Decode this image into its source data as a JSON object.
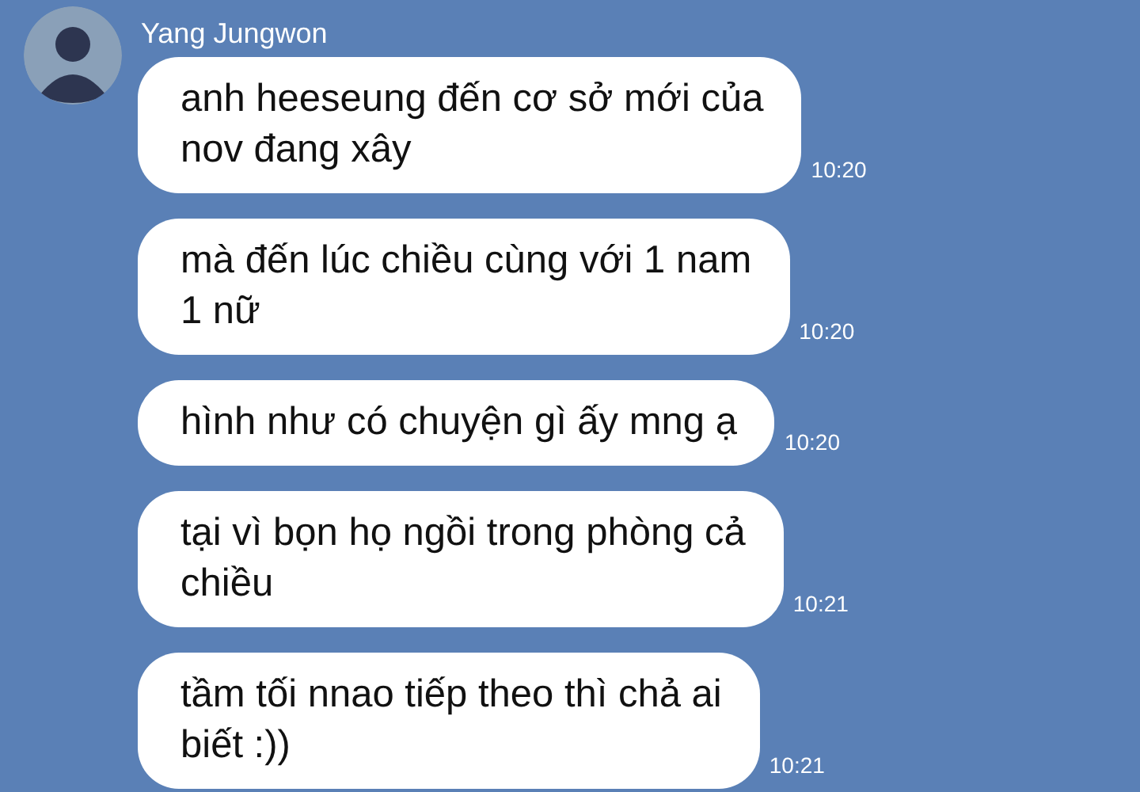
{
  "contact": {
    "name": "Yang Jungwon"
  },
  "messages": [
    {
      "text": "anh heeseung đến cơ sở mới của\nnov đang xây",
      "time": "10:20"
    },
    {
      "text": "mà đến lúc chiều cùng với 1 nam\n1 nữ",
      "time": "10:20"
    },
    {
      "text": "hình như có chuyện gì ấy mng ạ",
      "time": "10:20"
    },
    {
      "text": "tại vì bọn họ ngồi trong phòng cả\nchiều",
      "time": "10:21"
    },
    {
      "text": "tầm tối nnao tiếp theo thì chả ai\nbiết :))",
      "time": "10:21"
    }
  ]
}
